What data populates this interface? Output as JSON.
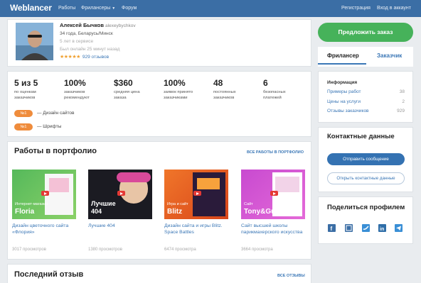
{
  "header": {
    "logo": "Weblancer",
    "nav": [
      "Работы",
      "Фрилансеры",
      "Форум"
    ],
    "register": "Регистрация",
    "login": "Вход в аккаунт"
  },
  "profile": {
    "name": "Алексей Бычков",
    "login": "alexeybychkov",
    "age_location": "34 года, Беларусь/Минск",
    "experience": "5 лет в сервисе",
    "last_seen": "Был онлайн 25 минут назад",
    "reviews": "929 отзывов",
    "rating_stars": 5
  },
  "actions": {
    "offer_order": "Предложить заказ"
  },
  "tabs": [
    "Фрилансер",
    "Заказчик"
  ],
  "stats": [
    {
      "value": "5 из 5",
      "label": "по оценкам заказчиков"
    },
    {
      "value": "100%",
      "label": "заказчиков рекомендуют"
    },
    {
      "value": "$360",
      "label": "средняя цена заказа"
    },
    {
      "value": "100%",
      "label": "заявок принято заказчиками"
    },
    {
      "value": "48",
      "label": "постоянных заказчиков"
    },
    {
      "value": "6",
      "label": "безопасных платежей"
    }
  ],
  "rankings": [
    {
      "badge": "№1",
      "text": "— Дизайн сайтов"
    },
    {
      "badge": "№1",
      "text": "— Шрифты"
    }
  ],
  "info": {
    "title": "Информация",
    "rows": [
      {
        "label": "Примеры работ",
        "value": "38"
      },
      {
        "label": "Цены на услуги",
        "value": "2"
      },
      {
        "label": "Отзывы заказчиков",
        "value": "929"
      }
    ]
  },
  "contacts": {
    "title": "Контактные данные",
    "send_message": "Отправить сообщение",
    "open_contacts": "Открыть контактные данные"
  },
  "share": {
    "title": "Поделиться профилем",
    "icons": [
      "facebook-icon",
      "vk-icon",
      "twitter-icon",
      "linkedin-icon",
      "telegram-icon"
    ]
  },
  "portfolio": {
    "title": "Работы в портфолио",
    "all_link": "ВСЕ РАБОТЫ В ПОРТФОЛИО",
    "items": [
      {
        "title": "Дизайн цветочного сайта «Флория»",
        "views": "3017 просмотров",
        "thumb_small": "Интернет-магазин",
        "thumb_big": "Floria"
      },
      {
        "title": "Лучшие 404",
        "views": "1380 просмотров",
        "thumb_small": "",
        "thumb_big": "Лучшие\n404"
      },
      {
        "title": "Дизайн сайта и игры Blitz. Space Battles",
        "views": "6474 просмотра",
        "thumb_small": "Игра и сайт",
        "thumb_big": "Blitz"
      },
      {
        "title": "Сайт высшей школы парикмахерского искусства",
        "views": "3664 просмотра",
        "thumb_small": "Сайт",
        "thumb_big": "Tony&Guy"
      }
    ]
  },
  "last_review": {
    "title": "Последний отзыв",
    "all_link": "ВСЕ ОТЗЫВЫ"
  }
}
